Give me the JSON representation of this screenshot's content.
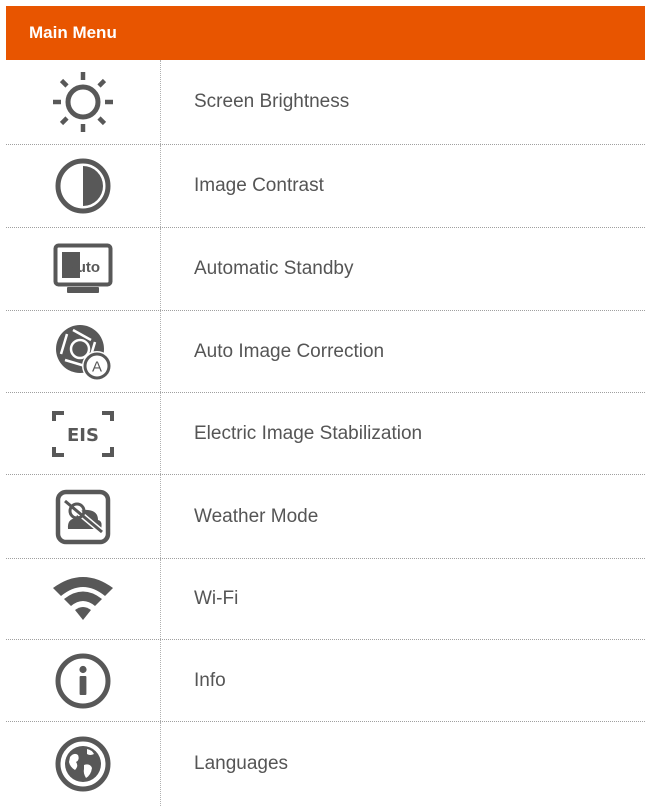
{
  "header": {
    "title": "Main Menu"
  },
  "colors": {
    "accent": "#e85500",
    "icon": "#585858"
  },
  "items": [
    {
      "label": "Screen Brightness",
      "icon": "sun-icon"
    },
    {
      "label": "Image Contrast",
      "icon": "contrast-icon"
    },
    {
      "label": "Automatic Standby",
      "icon": "auto-monitor-icon",
      "icon_text": "Auto"
    },
    {
      "label": "Auto Image Correction",
      "icon": "shutter-auto-icon",
      "icon_text": "A"
    },
    {
      "label": "Electric Image Stabilization",
      "icon": "eis-icon",
      "icon_text": "EIS"
    },
    {
      "label": "Weather Mode",
      "icon": "weather-icon"
    },
    {
      "label": "Wi-Fi",
      "icon": "wifi-icon"
    },
    {
      "label": "Info",
      "icon": "info-icon"
    },
    {
      "label": "Languages",
      "icon": "globe-icon"
    }
  ]
}
